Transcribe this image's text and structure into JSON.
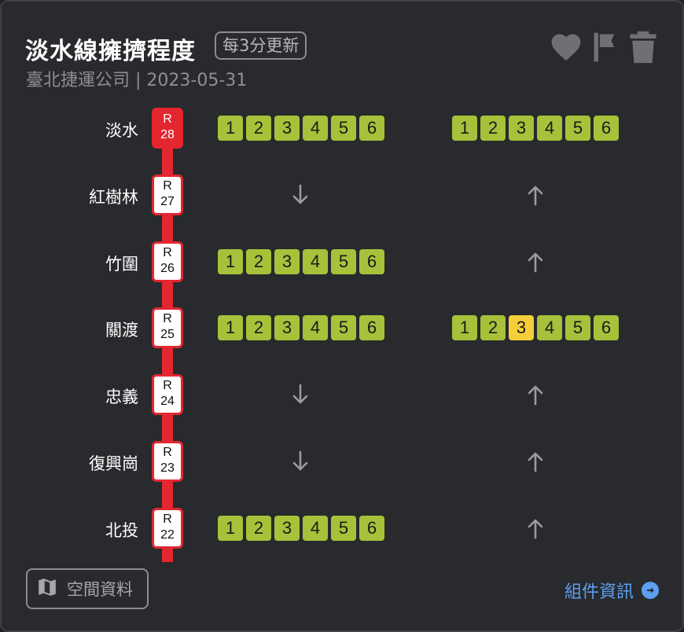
{
  "header": {
    "title": "淡水線擁擠程度",
    "update_badge": "每3分更新",
    "subtitle": "臺北捷運公司 | 2023-05-31"
  },
  "toolbar": {
    "favorite_icon": "heart-icon",
    "report_icon": "flag-icon",
    "delete_icon": "trash-icon"
  },
  "colors": {
    "line_red": "#e3262f",
    "car_normal": "#a8c13a",
    "car_busy": "#f5cf3a",
    "link_blue": "#5f9ff0"
  },
  "stations": [
    {
      "name": "淡水",
      "code_prefix": "R",
      "code_num": "28",
      "terminal": true,
      "southbound": {
        "type": "train",
        "cars": [
          "1",
          "2",
          "3",
          "4",
          "5",
          "6"
        ],
        "busy": []
      },
      "northbound": {
        "type": "train",
        "cars": [
          "1",
          "2",
          "3",
          "4",
          "5",
          "6"
        ],
        "busy": []
      }
    },
    {
      "name": "紅樹林",
      "code_prefix": "R",
      "code_num": "27",
      "terminal": false,
      "southbound": {
        "type": "arrow-down"
      },
      "northbound": {
        "type": "arrow-up"
      }
    },
    {
      "name": "竹圍",
      "code_prefix": "R",
      "code_num": "26",
      "terminal": false,
      "southbound": {
        "type": "train",
        "cars": [
          "1",
          "2",
          "3",
          "4",
          "5",
          "6"
        ],
        "busy": []
      },
      "northbound": {
        "type": "arrow-up"
      }
    },
    {
      "name": "關渡",
      "code_prefix": "R",
      "code_num": "25",
      "terminal": false,
      "southbound": {
        "type": "train",
        "cars": [
          "1",
          "2",
          "3",
          "4",
          "5",
          "6"
        ],
        "busy": []
      },
      "northbound": {
        "type": "train",
        "cars": [
          "1",
          "2",
          "3",
          "4",
          "5",
          "6"
        ],
        "busy": [
          2
        ]
      }
    },
    {
      "name": "忠義",
      "code_prefix": "R",
      "code_num": "24",
      "terminal": false,
      "southbound": {
        "type": "arrow-down"
      },
      "northbound": {
        "type": "arrow-up"
      }
    },
    {
      "name": "復興崗",
      "code_prefix": "R",
      "code_num": "23",
      "terminal": false,
      "southbound": {
        "type": "arrow-down"
      },
      "northbound": {
        "type": "arrow-up"
      }
    },
    {
      "name": "北投",
      "code_prefix": "R",
      "code_num": "22",
      "terminal": false,
      "southbound": {
        "type": "train",
        "cars": [
          "1",
          "2",
          "3",
          "4",
          "5",
          "6"
        ],
        "busy": []
      },
      "northbound": {
        "type": "arrow-up"
      }
    }
  ],
  "footer": {
    "map_button_label": "空間資料",
    "map_icon": "map-icon",
    "info_link_label": "組件資訊",
    "info_icon": "arrow-circle-right-icon"
  }
}
